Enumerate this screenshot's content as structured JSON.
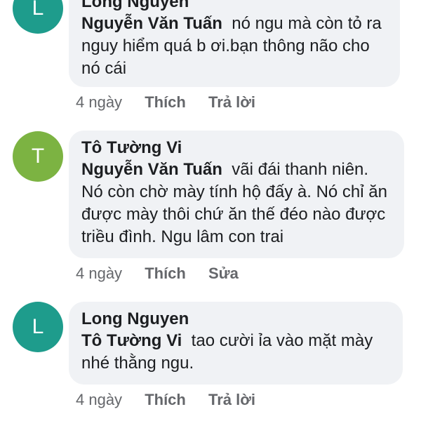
{
  "comments": [
    {
      "avatar_letter": "L",
      "avatar_color": "#1e9c8c",
      "author": "Long Nguyen",
      "mention": "Nguyễn Văn Tuấn",
      "text": "nó ngu mà còn tỏ ra nguy hiểm quá b ơi.bạn thông não cho nó cái",
      "time": "4 ngày",
      "actions": [
        "Thích",
        "Trả lời"
      ]
    },
    {
      "avatar_letter": "T",
      "avatar_color": "#7cb342",
      "author": "Tô Tường Vi",
      "mention": "Nguyễn Văn Tuấn",
      "text": "vãi đái thanh niên. Nó còn chờ mày tính hộ đấy à. Nó chỉ ăn được mày thôi chứ ăn thế đéo nào được triều đình. Ngu lâm con trai",
      "time": "4 ngày",
      "actions": [
        "Thích",
        "Sửa"
      ]
    },
    {
      "avatar_letter": "L",
      "avatar_color": "#1e9c8c",
      "author": "Long Nguyen",
      "mention": "Tô Tường Vi",
      "text": "tao cười ỉa vào mặt mày nhé thằng ngu.",
      "time": "4 ngày",
      "actions": [
        "Thích",
        "Trả lời"
      ]
    }
  ]
}
